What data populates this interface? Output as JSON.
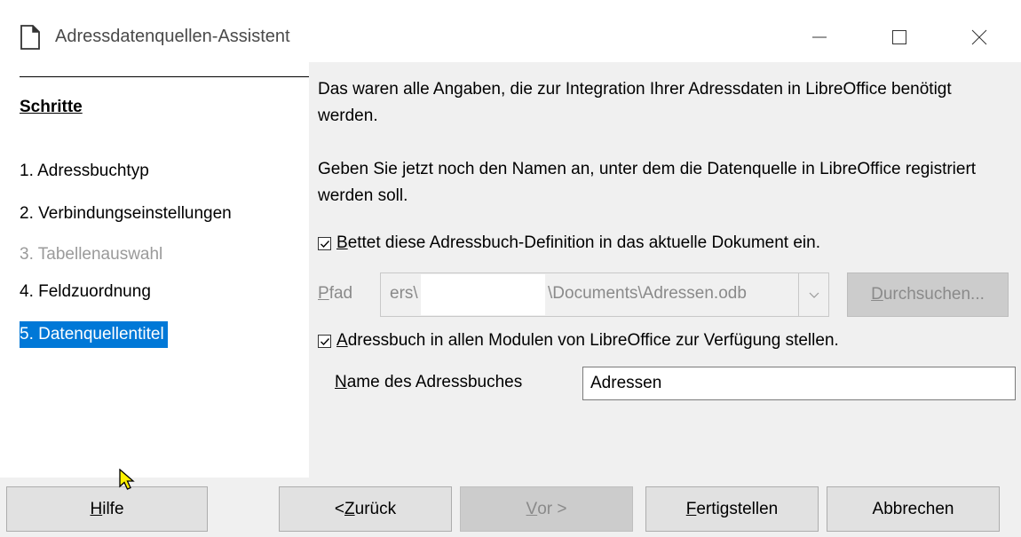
{
  "window": {
    "title": "Adressdatenquellen-Assistent",
    "icon": "document-icon",
    "controls": {
      "minimize": "minimize-icon",
      "maximize": "maximize-icon",
      "close": "close-icon"
    }
  },
  "sidebar": {
    "title": "Schritte",
    "steps": [
      {
        "label": "1. Adressbuchtyp",
        "state": "normal"
      },
      {
        "label": "2. Verbindungseinstellungen",
        "state": "normal"
      },
      {
        "label": "3. Tabellenauswahl",
        "state": "disabled"
      },
      {
        "label": "4. Feldzuordnung",
        "state": "normal"
      },
      {
        "label": "5. Datenquellentitel",
        "state": "active"
      }
    ]
  },
  "content": {
    "intro": "Das waren alle Angaben, die zur Integration Ihrer Adressdaten in LibreOffice benötigt werden.",
    "instruction": "Geben Sie jetzt noch den Namen an, unter dem die Datenquelle in LibreOffice registriert werden soll.",
    "embed_checkbox": {
      "label_first": "B",
      "label_rest": "ettet diese Adressbuch-Definition in das aktuelle Dokument ein.",
      "checked": true
    },
    "path": {
      "label_first": "P",
      "label_rest": "fad",
      "value_start": "ers\\",
      "value_end": "\\Documents\\Adressen.odb",
      "browse_first": "D",
      "browse_rest": "urchsuchen..."
    },
    "global_checkbox": {
      "label_first": "A",
      "label_rest": "dressbuch in allen Modulen von LibreOffice zur Verfügung stellen.",
      "checked": true
    },
    "name": {
      "label_first": "N",
      "label_rest": "ame des Adressbuches",
      "value": "Adressen"
    }
  },
  "buttons": {
    "help_first": "H",
    "help_rest": "ilfe",
    "back_pre": "< ",
    "back_first": "Z",
    "back_rest": "urück",
    "next_first": "V",
    "next_rest": "or >",
    "finish_first": "F",
    "finish_rest": "ertigstellen",
    "cancel": "Abbrechen"
  },
  "colors": {
    "accent": "#0078d7",
    "panel": "#f0f0f0",
    "disabled_text": "#8a8a8a"
  }
}
